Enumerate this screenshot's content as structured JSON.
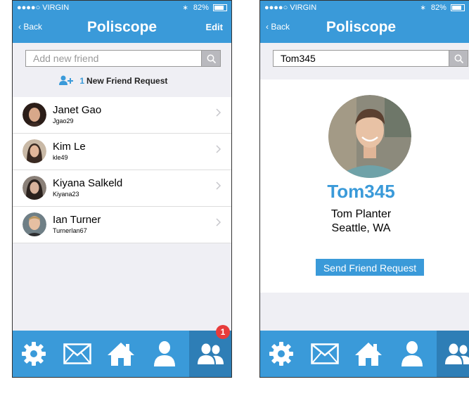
{
  "colors": {
    "accent": "#3a9ad9",
    "accent_dark": "#2e7eb6",
    "badge": "#e73b3b",
    "background": "#efeff4"
  },
  "status_bar": {
    "carrier": "●●●●○ VIRGIN",
    "bluetooth": "∗",
    "battery": "82%"
  },
  "friends_screen": {
    "nav": {
      "back": "Back",
      "title": "Poliscope",
      "edit": "Edit"
    },
    "search": {
      "placeholder": "Add new friend",
      "value": ""
    },
    "friend_request": {
      "count": "1",
      "label": "New Friend Request"
    },
    "friends": [
      {
        "name": "Janet Gao",
        "username": "Jgao29"
      },
      {
        "name": "Kim Le",
        "username": "kle49"
      },
      {
        "name": "Kiyana Salkeld",
        "username": "Kiyana23"
      },
      {
        "name": "Ian Turner",
        "username": "TurnerIan67"
      }
    ],
    "tab_badge": "1"
  },
  "profile_screen": {
    "nav": {
      "back": "Back",
      "title": "Poliscope"
    },
    "search": {
      "value": "Tom345"
    },
    "profile": {
      "username": "Tom345",
      "full_name": "Tom Planter",
      "location": "Seattle, WA",
      "action": "Send Friend Request"
    }
  },
  "tabs": [
    "settings-icon",
    "mail-icon",
    "home-icon",
    "profile-icon",
    "friends-icon"
  ]
}
